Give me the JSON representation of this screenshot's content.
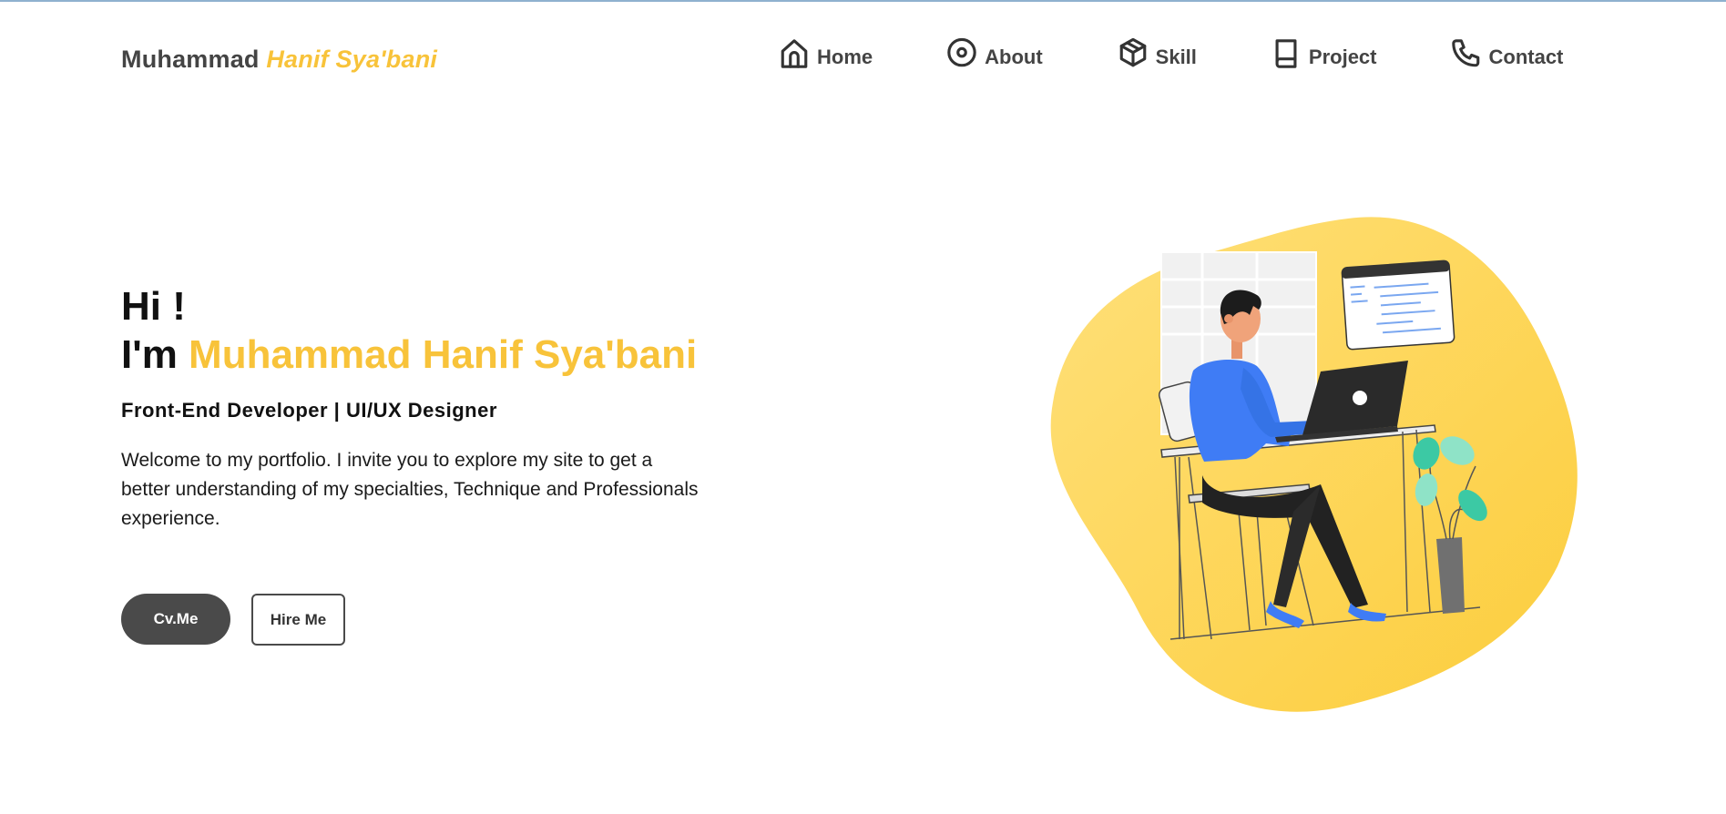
{
  "header": {
    "brand_first": "Muhammad",
    "brand_accent": "Hanif Sya'bani"
  },
  "nav": {
    "items": [
      {
        "label": "Home",
        "icon": "home-icon"
      },
      {
        "label": "About",
        "icon": "disc-icon"
      },
      {
        "label": "Skill",
        "icon": "box-icon"
      },
      {
        "label": "Project",
        "icon": "book-icon"
      },
      {
        "label": "Contact",
        "icon": "phone-icon"
      }
    ]
  },
  "hero": {
    "greeting": "Hi !",
    "im": "I'm",
    "name": "Muhammad Hanif Sya'bani",
    "role": "Front-End Developer | UI/UX Designer",
    "intro": "Welcome to my portfolio. I invite you to explore my site to get a better understanding of my specialties, Technique and Professionals experience.",
    "cv_button": "Cv.Me",
    "hire_button": "Hire Me"
  },
  "colors": {
    "accent": "#f8c33a",
    "dark": "#4a4a4a",
    "shirt": "#3f7cf5"
  }
}
